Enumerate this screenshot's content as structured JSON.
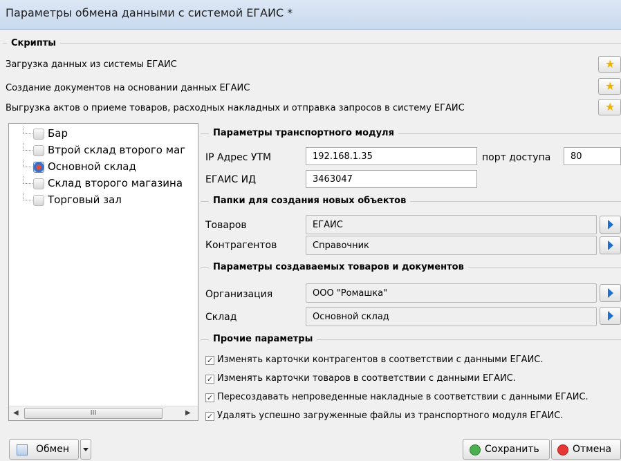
{
  "window": {
    "title": "Параметры обмена данными с системой ЕГАИС *"
  },
  "scripts": {
    "caption": "Скрипты",
    "items": [
      {
        "label": "Загрузка данных из системы ЕГАИС"
      },
      {
        "label": "Создание документов на основании данных ЕГАИС"
      },
      {
        "label": "Выгрузка актов о приеме  товаров, расходных накладных и отправка запросов в систему ЕГАИС"
      }
    ]
  },
  "tree": {
    "items": [
      {
        "label": "Бар",
        "active": false
      },
      {
        "label": "Втрой склад второго маг",
        "active": false
      },
      {
        "label": "Основной склад",
        "active": true
      },
      {
        "label": "Склад второго магазина",
        "active": false
      },
      {
        "label": "Торговый зал",
        "active": false
      }
    ],
    "scroll_thumb": "III"
  },
  "transport": {
    "caption": "Параметры транспортного модуля",
    "ip_label": "IP Адрес УТМ",
    "ip_value": "192.168.1.35",
    "port_label": "порт доступа",
    "port_value": "80",
    "egais_id_label": "ЕГАИС ИД",
    "egais_id_value": "3463047"
  },
  "folders": {
    "caption": "Папки для создания новых объектов",
    "goods_label": "Товаров",
    "goods_value": "ЕГАИС",
    "contractors_label": "Контрагентов",
    "contractors_value": "Справочник"
  },
  "created_params": {
    "caption": "Параметры создаваемых товаров и документов",
    "org_label": "Организация",
    "org_value": "ООО \"Ромашка\"",
    "warehouse_label": "Склад",
    "warehouse_value": "Основной склад"
  },
  "other": {
    "caption": "Прочие параметры",
    "checkboxes": [
      {
        "label": "Изменять карточки контрагентов в соответствии с данными ЕГАИС.",
        "checked": true
      },
      {
        "label": "Изменять карточки товаров в соответствии с данными ЕГАИС.",
        "checked": true
      },
      {
        "label": "Пересоздавать непроведенные накладные в соответствии с данными ЕГАИС.",
        "checked": true
      },
      {
        "label": "Удалять успешно загруженные файлы из транспортного модуля ЕГАИС.",
        "checked": true
      }
    ]
  },
  "footer": {
    "exchange_label": "Обмен",
    "save_label": "Сохранить",
    "cancel_label": "Отмена"
  },
  "colors": {
    "accent": "#1d6fd1",
    "title_bg": "#c9d9ee",
    "star": "#f0b400",
    "save_icon": "#4caf50",
    "cancel_icon": "#e53935"
  }
}
